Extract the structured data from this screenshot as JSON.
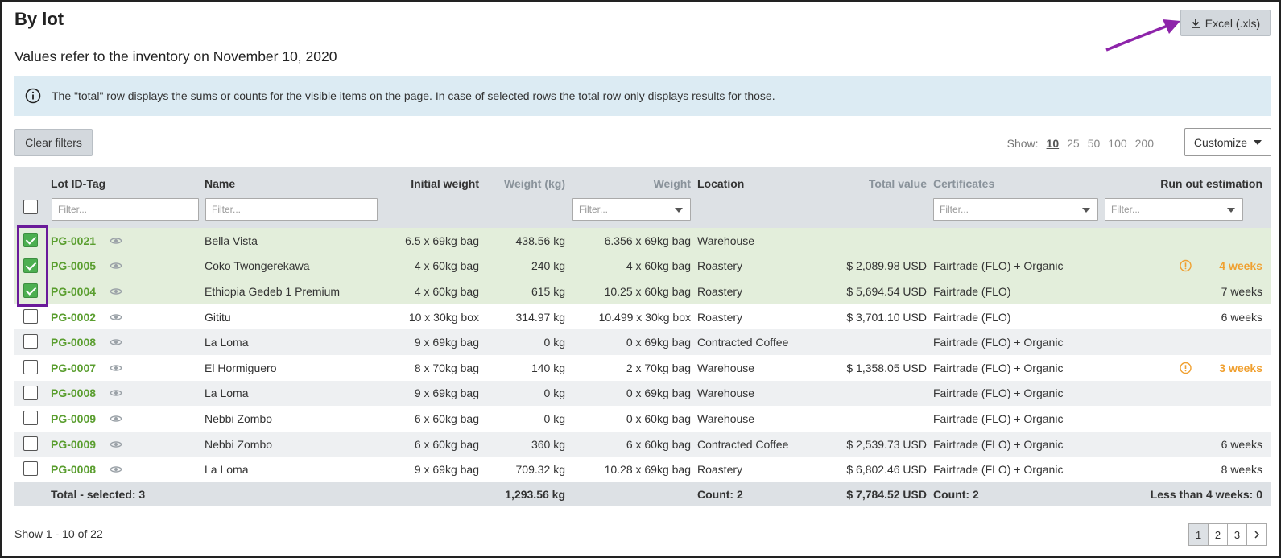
{
  "header": {
    "title": "By lot",
    "subtitle": "Values refer to the inventory on November 10, 2020",
    "export_label": "Excel (.xls)"
  },
  "info": {
    "text": "The \"total\" row displays the sums or counts for the visible items on the page. In case of selected rows the total row only displays results for those."
  },
  "toolbar": {
    "clear_filters": "Clear filters",
    "show_label": "Show:",
    "page_sizes": [
      "10",
      "25",
      "50",
      "100",
      "200"
    ],
    "active_page_size": "10",
    "customize": "Customize"
  },
  "table": {
    "columns": {
      "lot": "Lot ID-Tag",
      "name": "Name",
      "initial_weight": "Initial weight",
      "weight_kg": "Weight (kg)",
      "weight": "Weight",
      "location": "Location",
      "total_value": "Total value",
      "certificates": "Certificates",
      "run_out": "Run out estimation"
    },
    "filter_placeholder": "Filter...",
    "rows": [
      {
        "lot": "PG-0021",
        "name": "Bella Vista",
        "initial_weight": "6.5 x 69kg bag",
        "weight_kg": "438.56 kg",
        "weight": "6.356 x 69kg bag",
        "location": "Warehouse",
        "total_value": "",
        "certificates": "",
        "run_out": "",
        "selected": true,
        "warning": false
      },
      {
        "lot": "PG-0005",
        "name": "Coko Twongerekawa",
        "initial_weight": "4 x 60kg bag",
        "weight_kg": "240 kg",
        "weight": "4 x 60kg bag",
        "location": "Roastery",
        "total_value": "$ 2,089.98 USD",
        "certificates": "Fairtrade (FLO) + Organic",
        "run_out": "4 weeks",
        "selected": true,
        "warning": true
      },
      {
        "lot": "PG-0004",
        "name": "Ethiopia Gedeb 1 Premium",
        "initial_weight": "4 x 60kg bag",
        "weight_kg": "615 kg",
        "weight": "10.25 x 60kg bag",
        "location": "Roastery",
        "total_value": "$ 5,694.54 USD",
        "certificates": "Fairtrade (FLO)",
        "run_out": "7 weeks",
        "selected": true,
        "warning": false
      },
      {
        "lot": "PG-0002",
        "name": "Gititu",
        "initial_weight": "10 x 30kg box",
        "weight_kg": "314.97 kg",
        "weight": "10.499 x 30kg box",
        "location": "Roastery",
        "total_value": "$ 3,701.10 USD",
        "certificates": "Fairtrade (FLO)",
        "run_out": "6 weeks",
        "selected": false,
        "warning": false
      },
      {
        "lot": "PG-0008",
        "name": "La Loma",
        "initial_weight": "9 x 69kg bag",
        "weight_kg": "0 kg",
        "weight": "0 x 69kg bag",
        "location": "Contracted Coffee",
        "total_value": "",
        "certificates": "Fairtrade (FLO) + Organic",
        "run_out": "",
        "selected": false,
        "warning": false
      },
      {
        "lot": "PG-0007",
        "name": "El Hormiguero",
        "initial_weight": "8 x 70kg bag",
        "weight_kg": "140 kg",
        "weight": "2 x 70kg bag",
        "location": "Warehouse",
        "total_value": "$ 1,358.05 USD",
        "certificates": "Fairtrade (FLO) + Organic",
        "run_out": "3 weeks",
        "selected": false,
        "warning": true
      },
      {
        "lot": "PG-0008",
        "name": "La Loma",
        "initial_weight": "9 x 69kg bag",
        "weight_kg": "0 kg",
        "weight": "0 x 69kg bag",
        "location": "Warehouse",
        "total_value": "",
        "certificates": "Fairtrade (FLO) + Organic",
        "run_out": "",
        "selected": false,
        "warning": false
      },
      {
        "lot": "PG-0009",
        "name": "Nebbi Zombo",
        "initial_weight": "6 x 60kg bag",
        "weight_kg": "0 kg",
        "weight": "0 x 60kg bag",
        "location": "Warehouse",
        "total_value": "",
        "certificates": "Fairtrade (FLO) + Organic",
        "run_out": "",
        "selected": false,
        "warning": false
      },
      {
        "lot": "PG-0009",
        "name": "Nebbi Zombo",
        "initial_weight": "6 x 60kg bag",
        "weight_kg": "360 kg",
        "weight": "6 x 60kg bag",
        "location": "Contracted Coffee",
        "total_value": "$ 2,539.73 USD",
        "certificates": "Fairtrade (FLO) + Organic",
        "run_out": "6 weeks",
        "selected": false,
        "warning": false
      },
      {
        "lot": "PG-0008",
        "name": "La Loma",
        "initial_weight": "9 x 69kg bag",
        "weight_kg": "709.32 kg",
        "weight": "10.28 x 69kg bag",
        "location": "Roastery",
        "total_value": "$ 6,802.46 USD",
        "certificates": "Fairtrade (FLO) + Organic",
        "run_out": "8 weeks",
        "selected": false,
        "warning": false
      }
    ],
    "totals": {
      "label": "Total - selected: 3",
      "weight_kg": "1,293.56 kg",
      "location": "Count: 2",
      "total_value": "$ 7,784.52 USD",
      "certificates": "Count: 2",
      "run_out": "Less than 4 weeks: 0"
    }
  },
  "pagination": {
    "summary": "Show 1 - 10 of 22",
    "pages": [
      "1",
      "2",
      "3"
    ],
    "active_page": "1"
  },
  "colors": {
    "lot_link": "#5a9e2f",
    "warning": "#f0a030",
    "selected_row": "#e3eedb",
    "annotation": "#6a1b9a"
  },
  "icons": [
    "download-icon",
    "info-icon",
    "eye-icon",
    "warning-icon",
    "chevron-right-icon"
  ]
}
